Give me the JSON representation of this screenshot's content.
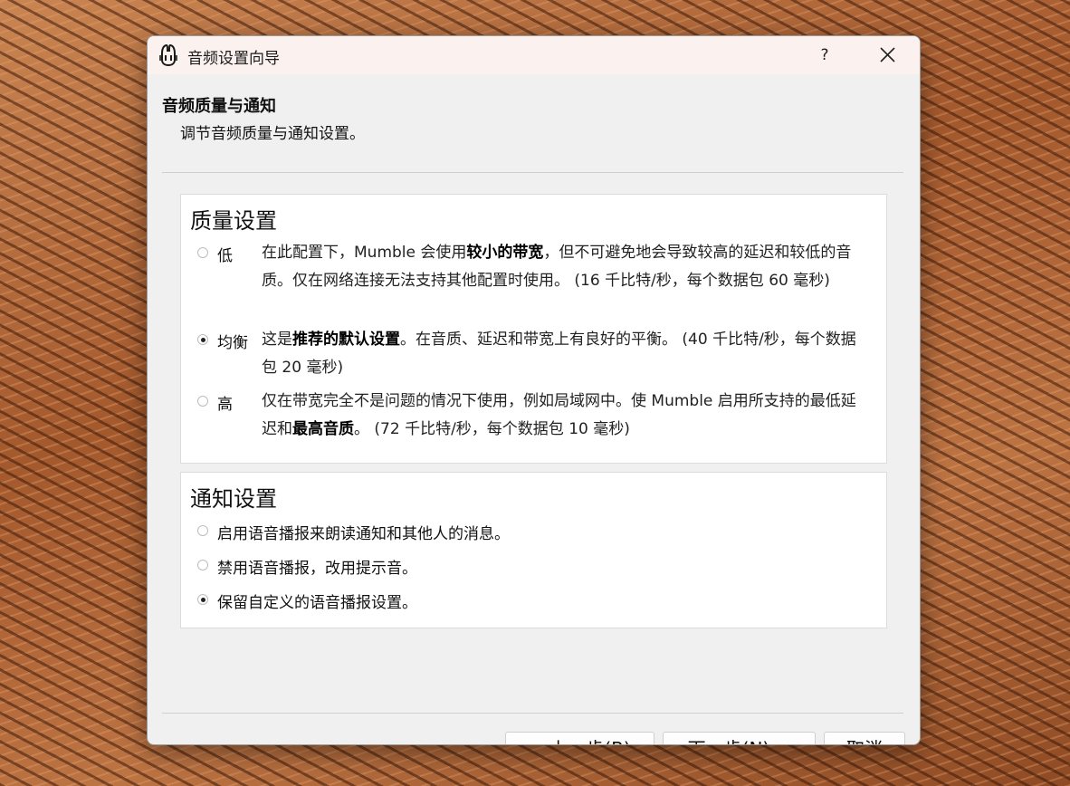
{
  "window": {
    "title": "音频设置向导",
    "help_label": "?",
    "icon": "mumble-logo-icon"
  },
  "page": {
    "title": "音频质量与通知",
    "subtitle": "调节音频质量与通知设置。"
  },
  "quality": {
    "title": "质量设置",
    "options": [
      {
        "label": "低",
        "selected": false,
        "pre": "在此配置下，Mumble 会使用",
        "bold": "较小的带宽",
        "post": "，但不可避免地会导致较高的延迟和较低的音质。仅在网络连接无法支持其他配置时使用。 (16 千比特/秒，每个数据包 60 毫秒)"
      },
      {
        "label": "均衡",
        "selected": true,
        "pre": "这是",
        "bold": "推荐的默认设置",
        "post": "。在音质、延迟和带宽上有良好的平衡。 (40 千比特/秒，每个数据包 20 毫秒)"
      },
      {
        "label": "高",
        "selected": false,
        "pre": "仅在带宽完全不是问题的情况下使用，例如局域网中。使 Mumble 启用所支持的最低延迟和",
        "bold": "最高音质",
        "post": "。 (72 千比特/秒，每个数据包 10 毫秒)"
      }
    ]
  },
  "notification": {
    "title": "通知设置",
    "options": [
      {
        "label": "启用语音播报来朗读通知和其他人的消息。",
        "selected": false
      },
      {
        "label": "禁用语音播报，改用提示音。",
        "selected": false
      },
      {
        "label": "保留自定义的语音播报设置。",
        "selected": true
      }
    ]
  },
  "buttons": {
    "back": "< 上一步(B)",
    "next": "下一步(N) >",
    "cancel": "取消"
  }
}
